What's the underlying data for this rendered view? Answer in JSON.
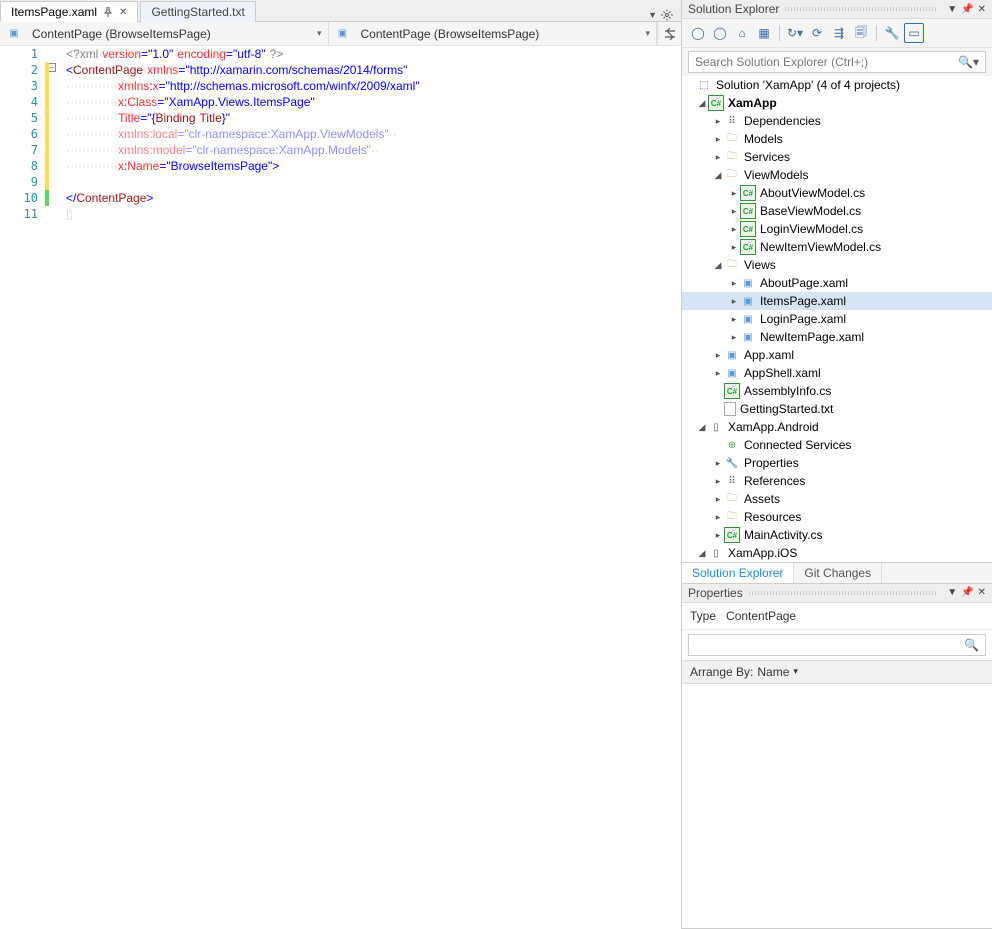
{
  "tabs": {
    "active": {
      "label": "ItemsPage.xaml"
    },
    "inactive": {
      "label": "GettingStarted.txt"
    }
  },
  "crumbs": {
    "left": "ContentPage (BrowseItemsPage)",
    "right": "ContentPage (BrowseItemsPage)"
  },
  "code": {
    "lines": [
      1,
      2,
      3,
      4,
      5,
      6,
      7,
      8,
      9,
      10,
      11
    ],
    "l1": {
      "a": "<?",
      "b": "xml",
      "c": "version",
      "d": "\"1.0\"",
      "e": "encoding",
      "f": "\"utf-8\"",
      "g": "?>"
    },
    "l2": {
      "a": "<",
      "b": "ContentPage",
      "c": "xmlns",
      "d": "\"http://xamarin.com/schemas/2014/forms\""
    },
    "l3": {
      "a": "xmlns",
      "b": "x",
      "c": "\"http://schemas.microsoft.com/winfx/2009/xaml\""
    },
    "l4": {
      "a": "x",
      "b": "Class",
      "c": "\"XamApp.Views.ItemsPage\""
    },
    "l5": {
      "a": "Title",
      "b": "\"",
      "c": "{",
      "d": "Binding",
      "e": "Title",
      "f": "}",
      "g": "\""
    },
    "l6": {
      "a": "xmlns",
      "b": "local",
      "c": "\"clr-namespace:XamApp.ViewModels\""
    },
    "l7": {
      "a": "xmlns",
      "b": "model",
      "c": "\"clr-namespace:XamApp.Models\""
    },
    "l8": {
      "a": "x",
      "b": "Name",
      "c": "\"BrowseItemsPage\"",
      "d": ">"
    },
    "l10": {
      "a": "</",
      "b": "ContentPage",
      "c": ">"
    }
  },
  "solutionExplorer": {
    "title": "Solution Explorer",
    "searchPlaceholder": "Search Solution Explorer (Ctrl+;)",
    "root": "Solution 'XamApp' (4 of 4 projects)",
    "items": {
      "p0": "XamApp",
      "p0_dep": "Dependencies",
      "p0_models": "Models",
      "p0_services": "Services",
      "p0_vm": "ViewModels",
      "p0_vm_0": "AboutViewModel.cs",
      "p0_vm_1": "BaseViewModel.cs",
      "p0_vm_2": "LoginViewModel.cs",
      "p0_vm_3": "NewItemViewModel.cs",
      "p0_views": "Views",
      "p0_views_0": "AboutPage.xaml",
      "p0_views_1": "ItemsPage.xaml",
      "p0_views_2": "LoginPage.xaml",
      "p0_views_3": "NewItemPage.xaml",
      "p0_app": "App.xaml",
      "p0_shell": "AppShell.xaml",
      "p0_asm": "AssemblyInfo.cs",
      "p0_gs": "GettingStarted.txt",
      "p1": "XamApp.Android",
      "p1_cs": "Connected Services",
      "p1_prop": "Properties",
      "p1_ref": "References",
      "p1_assets": "Assets",
      "p1_res": "Resources",
      "p1_main": "MainActivity.cs",
      "p2": "XamApp.iOS"
    },
    "bottomTabs": {
      "a": "Solution Explorer",
      "b": "Git Changes"
    }
  },
  "properties": {
    "title": "Properties",
    "typeLabel": "Type",
    "typeValue": "ContentPage",
    "arrange": "Arrange By:",
    "arrangeVal": "Name"
  }
}
